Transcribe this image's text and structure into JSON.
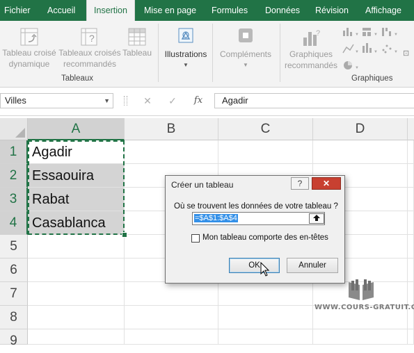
{
  "ribbon_tabs": [
    "Fichier",
    "Accueil",
    "Insertion",
    "Mise en page",
    "Formules",
    "Données",
    "Révision",
    "Affichage"
  ],
  "active_tab": "Insertion",
  "ribbon": {
    "tableaux": {
      "tableau_croise_line1": "Tableau croisé",
      "tableau_croise_line2": "dynamique",
      "tableaux_croises_line1": "Tableaux croisés",
      "tableaux_croises_line2": "recommandés",
      "tableau": "Tableau",
      "group_label": "Tableaux"
    },
    "illustrations": "Illustrations",
    "complements": "Compléments",
    "graphiques": {
      "graphiques_line1": "Graphiques",
      "graphiques_line2": "recommandés",
      "group_label": "Graphiques"
    }
  },
  "formula_bar": {
    "name_box": "Villes",
    "cancel_symbol": "✕",
    "enter_symbol": "✓",
    "fx_symbol": "fx",
    "content": "Agadir"
  },
  "grid": {
    "columns": [
      "A",
      "B",
      "C",
      "D"
    ],
    "rows": [
      "1",
      "2",
      "3",
      "4",
      "5",
      "6",
      "7",
      "8",
      "9"
    ],
    "column_a_values": [
      "Agadir",
      "Essaouira",
      "Rabat",
      "Casablanca"
    ]
  },
  "dialog": {
    "title": "Créer un tableau",
    "help": "?",
    "close": "✕",
    "question": "Où se trouvent les données de votre tableau ?",
    "range": "=$A$1:$A$4",
    "has_headers_label": "Mon tableau comporte des en-têtes",
    "has_headers_checked": false,
    "ok_label": "OK",
    "cancel_label": "Annuler"
  },
  "watermark": "WWW.COURS-GRATUIT.COM",
  "colors": {
    "excel_green": "#217346",
    "selection_fill": "#d4d4d4",
    "close_red": "#c84031"
  }
}
